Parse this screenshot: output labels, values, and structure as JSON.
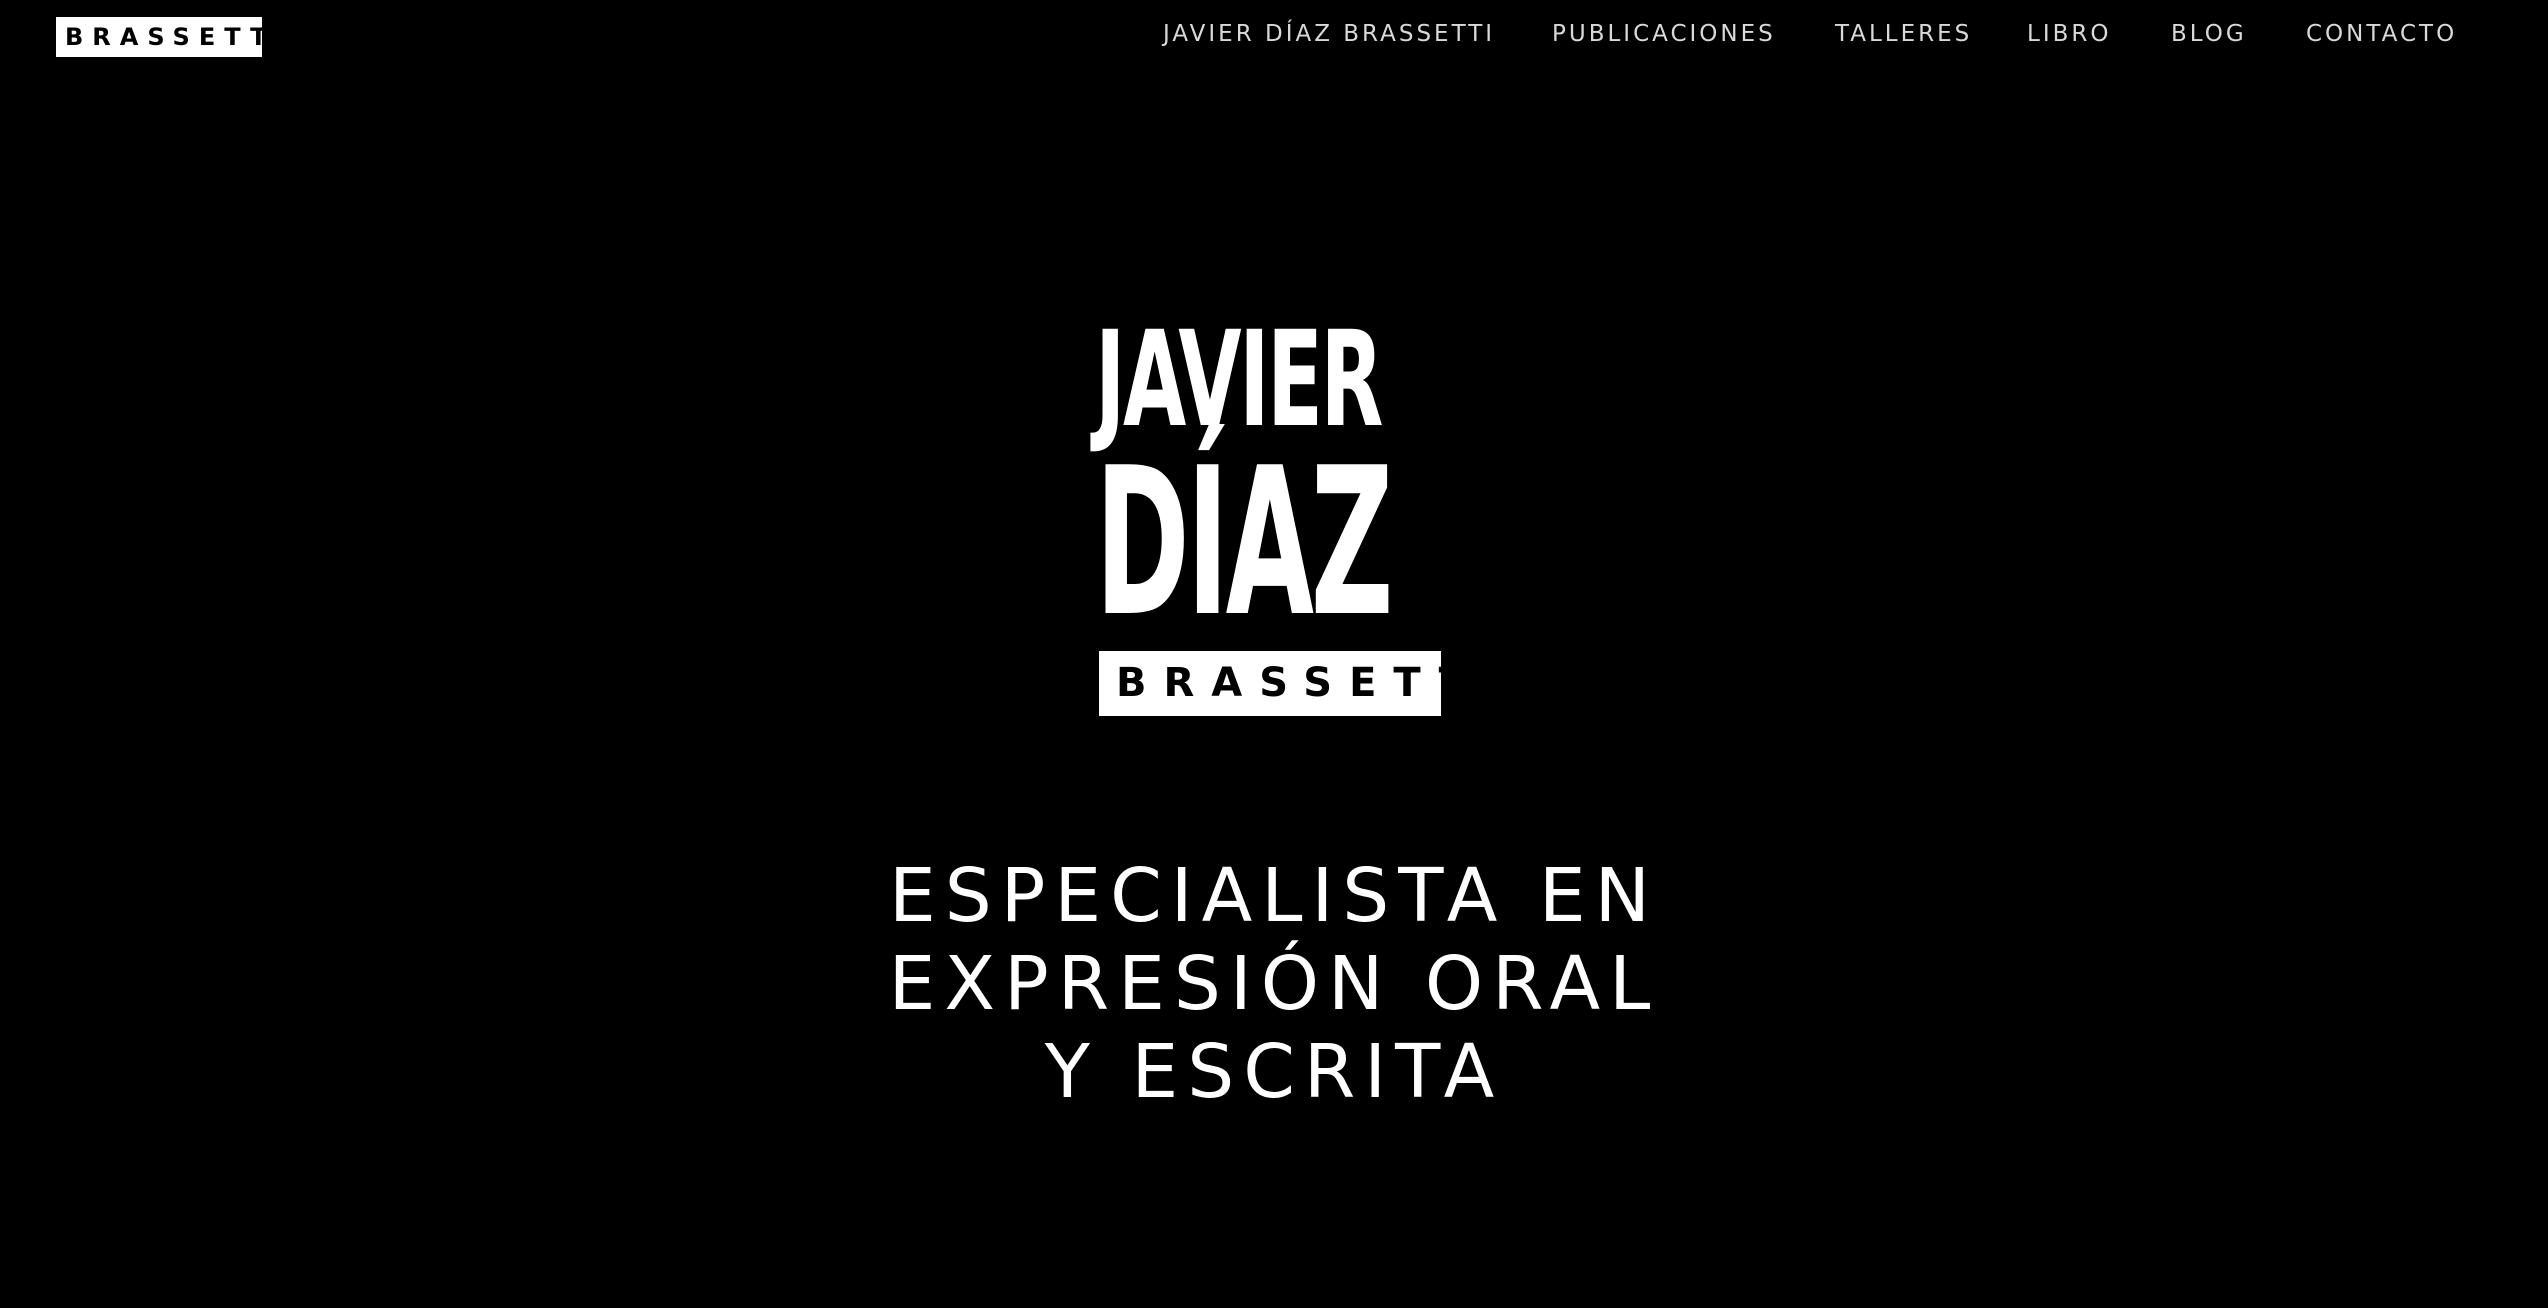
{
  "header": {
    "logo_text": "BRASSETTI",
    "nav": [
      {
        "label": "JAVIER DÍAZ BRASSETTI"
      },
      {
        "label": "PUBLICACIONES"
      },
      {
        "label": "TALLERES"
      },
      {
        "label": "LIBRO"
      },
      {
        "label": "BLOG"
      },
      {
        "label": "CONTACTO"
      }
    ]
  },
  "hero": {
    "logo_line1": "JAVIER",
    "logo_line2": "DÍAZ",
    "logo_plate": "BRASSETTI",
    "tagline": [
      "ESPECIALISTA EN",
      "EXPRESIÓN ORAL",
      "Y ESCRITA"
    ]
  },
  "colors": {
    "background": "#000000",
    "text": "#ffffff",
    "nav_text": "#d9d9d9"
  }
}
